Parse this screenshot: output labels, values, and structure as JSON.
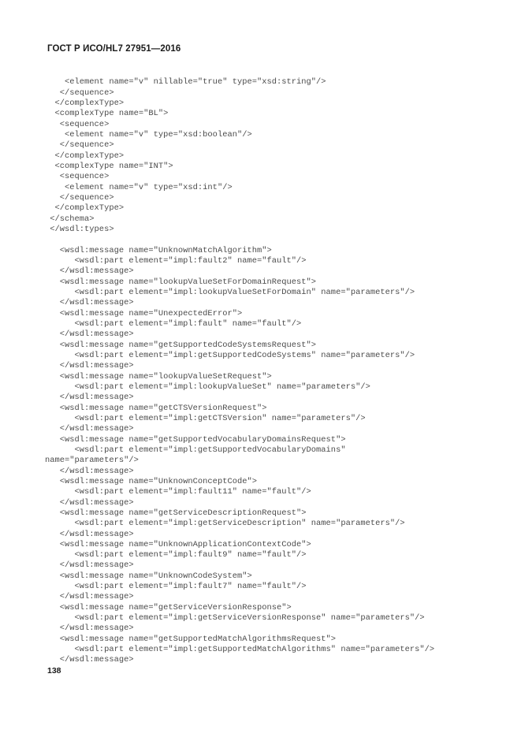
{
  "header": {
    "standard_title": "ГОСТ Р ИСО/HL7 27951—2016"
  },
  "footer": {
    "page_number": "138"
  },
  "colors": {
    "page_background": "#ffffff",
    "header_text": "#1b1b1b",
    "code_text": "#4a4a4a"
  },
  "code_listing": {
    "language": "xml-wsdl",
    "lines": [
      "    <element name=\"v\" nillable=\"true\" type=\"xsd:string\"/>",
      "   </sequence>",
      "  </complexType>",
      "  <complexType name=\"BL\">",
      "   <sequence>",
      "    <element name=\"v\" type=\"xsd:boolean\"/>",
      "   </sequence>",
      "  </complexType>",
      "  <complexType name=\"INT\">",
      "   <sequence>",
      "    <element name=\"v\" type=\"xsd:int\"/>",
      "   </sequence>",
      "  </complexType>",
      " </schema>",
      " </wsdl:types>",
      "",
      "   <wsdl:message name=\"UnknownMatchAlgorithm\">",
      "      <wsdl:part element=\"impl:fault2\" name=\"fault\"/>",
      "   </wsdl:message>",
      "   <wsdl:message name=\"lookupValueSetForDomainRequest\">",
      "      <wsdl:part element=\"impl:lookupValueSetForDomain\" name=\"parameters\"/>",
      "   </wsdl:message>",
      "   <wsdl:message name=\"UnexpectedError\">",
      "      <wsdl:part element=\"impl:fault\" name=\"fault\"/>",
      "   </wsdl:message>",
      "   <wsdl:message name=\"getSupportedCodeSystemsRequest\">",
      "      <wsdl:part element=\"impl:getSupportedCodeSystems\" name=\"parameters\"/>",
      "   </wsdl:message>",
      "   <wsdl:message name=\"lookupValueSetRequest\">",
      "      <wsdl:part element=\"impl:lookupValueSet\" name=\"parameters\"/>",
      "   </wsdl:message>",
      "   <wsdl:message name=\"getCTSVersionRequest\">",
      "      <wsdl:part element=\"impl:getCTSVersion\" name=\"parameters\"/>",
      "   </wsdl:message>",
      "   <wsdl:message name=\"getSupportedVocabularyDomainsRequest\">",
      "      <wsdl:part element=\"impl:getSupportedVocabularyDomains\"",
      "name=\"parameters\"/>",
      "   </wsdl:message>",
      "   <wsdl:message name=\"UnknownConceptCode\">",
      "      <wsdl:part element=\"impl:fault11\" name=\"fault\"/>",
      "   </wsdl:message>",
      "   <wsdl:message name=\"getServiceDescriptionRequest\">",
      "      <wsdl:part element=\"impl:getServiceDescription\" name=\"parameters\"/>",
      "   </wsdl:message>",
      "   <wsdl:message name=\"UnknownApplicationContextCode\">",
      "      <wsdl:part element=\"impl:fault9\" name=\"fault\"/>",
      "   </wsdl:message>",
      "   <wsdl:message name=\"UnknownCodeSystem\">",
      "      <wsdl:part element=\"impl:fault7\" name=\"fault\"/>",
      "   </wsdl:message>",
      "   <wsdl:message name=\"getServiceVersionResponse\">",
      "      <wsdl:part element=\"impl:getServiceVersionResponse\" name=\"parameters\"/>",
      "   </wsdl:message>",
      "   <wsdl:message name=\"getSupportedMatchAlgorithmsRequest\">",
      "      <wsdl:part element=\"impl:getSupportedMatchAlgorithms\" name=\"parameters\"/>",
      "   </wsdl:message>"
    ]
  }
}
